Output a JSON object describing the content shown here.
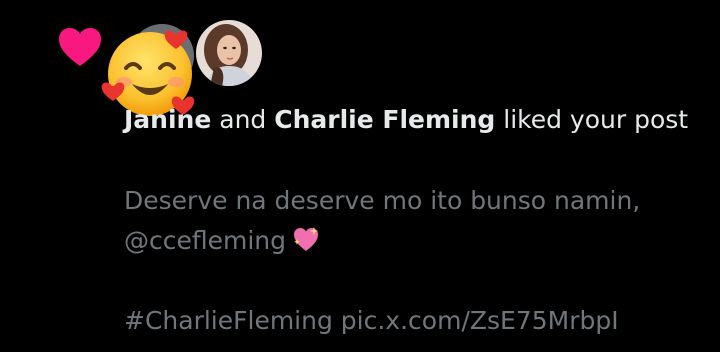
{
  "notification": {
    "actors": {
      "first_name": "Janine",
      "connector": " and ",
      "second_name": "Charlie Fleming"
    },
    "action_text": " liked your post",
    "post": {
      "line1": "Deserve na deserve mo ito bunso namin,",
      "mention": "@ccefleming",
      "hashtag": "#CharlieFleming",
      "media_link": "pic.x.com/ZsE75MrbpI"
    }
  },
  "colors": {
    "background": "#000000",
    "primary_text": "#e7e9ea",
    "secondary_text": "#71767b",
    "like_heart": "#f91880"
  },
  "icons": {
    "notification_type": "heart-icon",
    "emoji_overlay": "smiling-face-with-hearts-emoji",
    "inline_emoji": "sparkling-heart-emoji"
  }
}
